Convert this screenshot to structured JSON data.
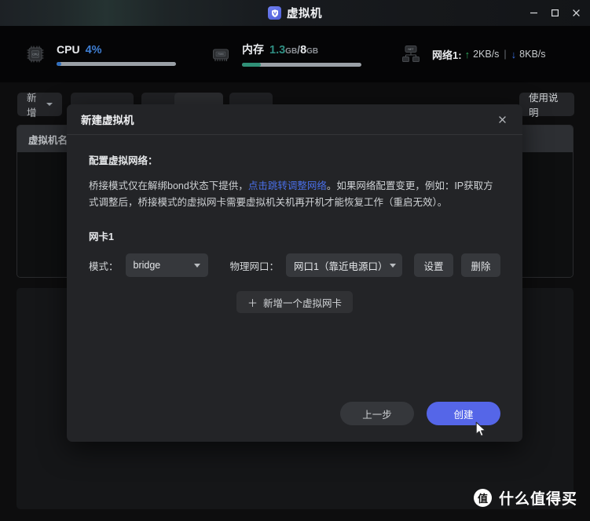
{
  "window": {
    "title": "虚拟机",
    "app_icon": "shield-v-icon",
    "controls": {
      "minimize": "minimize-icon",
      "maximize": "maximize-icon",
      "close": "close-icon"
    }
  },
  "stats": {
    "cpu": {
      "icon": "cpu-chip-icon",
      "label": "CPU",
      "value": "4%",
      "percent": 4,
      "bar_color": "#2f6fc0"
    },
    "memory": {
      "icon": "ram-chip-icon",
      "label": "内存",
      "used": "1.3",
      "used_unit": "GB",
      "separator": "/",
      "total": "8",
      "total_unit": "GB",
      "percent": 16,
      "bar_color": "#2f9077"
    },
    "network": {
      "icon": "network-icon",
      "label": "网络1:",
      "up_arrow": "↑",
      "up_rate": "2KB/s",
      "pipe": "|",
      "down_arrow": "↓",
      "down_rate": "8KB/s",
      "up_color": "#2faa5c",
      "down_color": "#3a6fe0"
    }
  },
  "toolbar": {
    "new_label": "新增",
    "new_caret": "chevron-down-icon",
    "btn2_label": "",
    "btn3_label": "",
    "btn4_label": "",
    "btn5_label": "",
    "help_label": "使用说明"
  },
  "table": {
    "columns": [
      "虚拟机名称"
    ]
  },
  "modal": {
    "title": "新建虚拟机",
    "close_icon": "close-icon",
    "section_label": "配置虚拟网络：",
    "description": {
      "part1": "桥接模式仅在解绑bond状态下提供，",
      "link": "点击跳转调整网络",
      "part2": "。如果网络配置变更，例如：IP获取方式调整后，桥接模式的虚拟网卡需要虚拟机关机再开机才能恢复工作（重启无效）。",
      "link_color": "#4a6fe8"
    },
    "nic": {
      "title": "网卡1",
      "mode_label": "模式：",
      "mode_value": "bridge",
      "mode_caret": "chevron-down-icon",
      "port_label": "物理网口：",
      "port_value": "网口1（靠近电源口）",
      "port_caret": "chevron-down-icon",
      "settings_button": "设置",
      "delete_button": "删除"
    },
    "add_nic": {
      "plus": "＋",
      "label": "新增一个虚拟网卡"
    },
    "footer": {
      "back_label": "上一步",
      "create_label": "创建",
      "create_color": "#5566e8"
    }
  },
  "watermark": {
    "badge": "值",
    "text": "什么值得买"
  }
}
